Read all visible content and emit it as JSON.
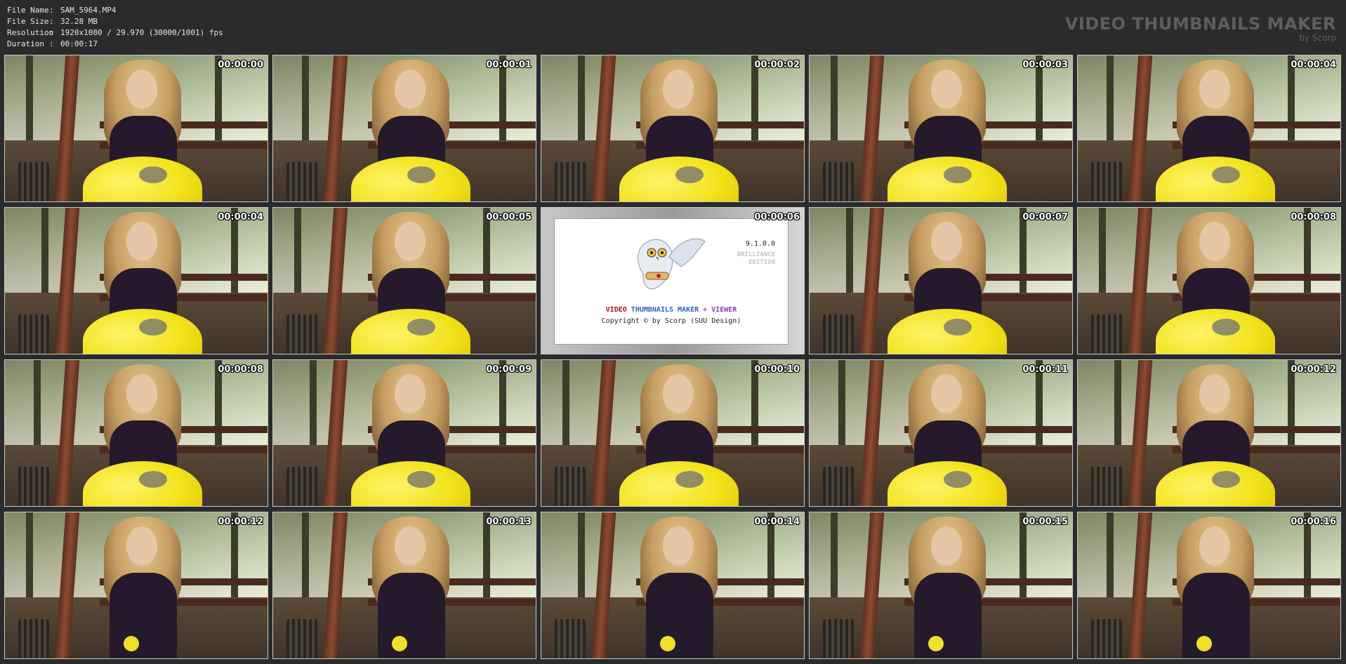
{
  "header": {
    "info": [
      {
        "key": "File Name",
        "value": "SAM_5964.MP4"
      },
      {
        "key": "File Size",
        "value": "32.28 MB"
      },
      {
        "key": "Resolution",
        "value": "1920x1080 / 29.970 (30000/1001) fps"
      },
      {
        "key": "Duration",
        "value": "00:00:17"
      }
    ],
    "separator": ":",
    "brand_title": "VIDEO THUMBNAILS MAKER",
    "brand_sub": "by Scorp"
  },
  "thumbnails": [
    {
      "time": "00:00:00"
    },
    {
      "time": "00:00:01"
    },
    {
      "time": "00:00:02"
    },
    {
      "time": "00:00:03"
    },
    {
      "time": "00:00:04"
    },
    {
      "time": "00:00:04"
    },
    {
      "time": "00:00:05"
    },
    {
      "time": "00:00:06"
    },
    {
      "time": "00:00:07"
    },
    {
      "time": "00:00:08"
    },
    {
      "time": "00:00:08"
    },
    {
      "time": "00:00:09"
    },
    {
      "time": "00:00:10"
    },
    {
      "time": "00:00:11"
    },
    {
      "time": "00:00:12"
    },
    {
      "time": "00:00:12"
    },
    {
      "time": "00:00:13"
    },
    {
      "time": "00:00:14"
    },
    {
      "time": "00:00:15"
    },
    {
      "time": "00:00:16"
    }
  ],
  "splash": {
    "version": "9.1.0.0",
    "edition_line1": "BRILLIANCE",
    "edition_line2": "EDITION",
    "title_video": "VIDEO",
    "title_thumbs": "THUMBNAILS MAKER",
    "title_viewer": "+ VIEWER",
    "copyright": "Copyright © by Scorp (SUU Design)"
  },
  "colors": {
    "background": "#2b2b2b",
    "balloon": "#f2e21a",
    "title_red": "#a8141b",
    "title_blue": "#2f63b8",
    "title_purple": "#8a3fb4"
  }
}
